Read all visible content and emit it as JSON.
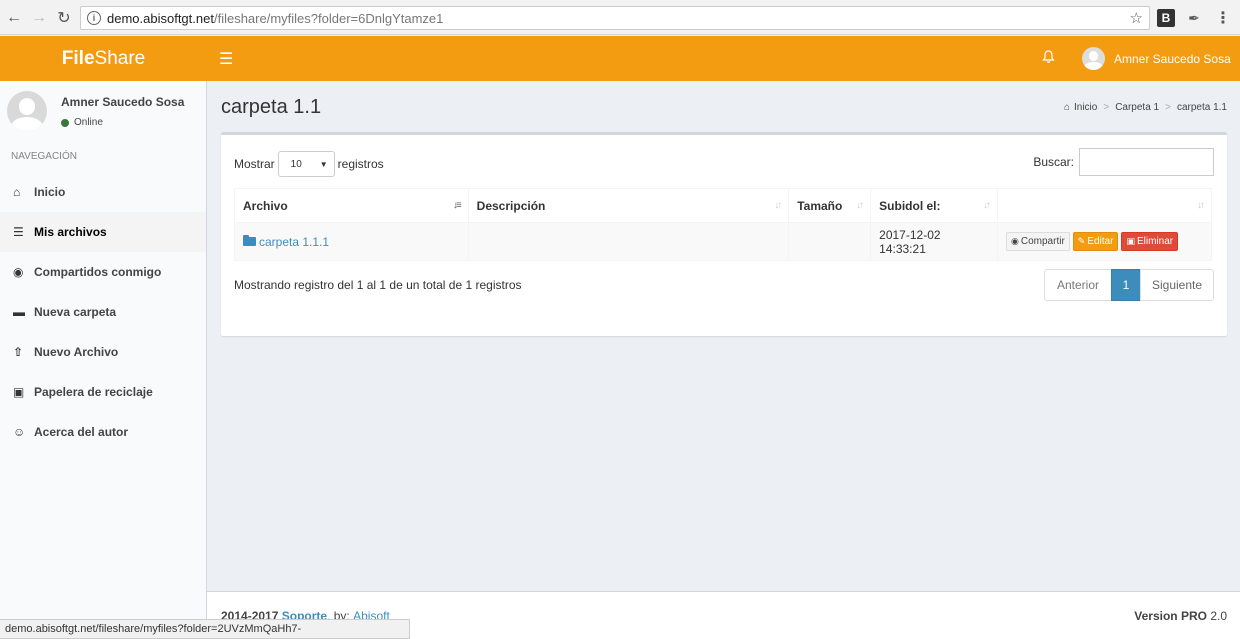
{
  "browser": {
    "url_host": "demo.abisoftgt.net",
    "url_path": "/fileshare/myfiles?folder=6DnlgYtamze1",
    "ext_b_label": "B"
  },
  "header": {
    "logo_bold": "File",
    "logo_rest": "Share",
    "user_name": "Amner Saucedo Sosa"
  },
  "sidebar": {
    "user_name": "Amner Saucedo Sosa",
    "status": "Online",
    "nav_header": "NAVEGACIÓN",
    "items": [
      {
        "label": "Inicio",
        "icon": "home-icon"
      },
      {
        "label": "Mis archivos",
        "icon": "database-icon"
      },
      {
        "label": "Compartidos conmigo",
        "icon": "globe-icon"
      },
      {
        "label": "Nueva carpeta",
        "icon": "folder-icon"
      },
      {
        "label": "Nuevo Archivo",
        "icon": "upload-icon"
      },
      {
        "label": "Papelera de reciclaje",
        "icon": "trash-icon"
      },
      {
        "label": "Acerca del autor",
        "icon": "smile-icon"
      }
    ]
  },
  "content": {
    "title": "carpeta 1.1",
    "breadcrumb": [
      "Inicio",
      "Carpeta 1",
      "carpeta 1.1"
    ]
  },
  "table_controls": {
    "show_label": "Mostrar",
    "page_size": "10",
    "records_label": "registros",
    "search_label": "Buscar:",
    "search_value": ""
  },
  "table": {
    "columns": [
      "Archivo",
      "Descripción",
      "Tamaño",
      "Subidol el:",
      ""
    ],
    "rows": [
      {
        "archivo": "carpeta 1.1.1",
        "descripcion": "",
        "tamano": "",
        "subido": "2017-12-02 14:33:21",
        "actions": [
          "Compartir",
          "Editar",
          "Eliminar"
        ]
      }
    ]
  },
  "pagination": {
    "info": "Mostrando registro del 1 al 1 de un total de 1 registros",
    "prev": "Anterior",
    "current": "1",
    "next": "Siguiente"
  },
  "footer": {
    "copyright": "2014-2017",
    "support_link": "Soporte",
    "by_label": ". by:",
    "author_link": "Abisoft",
    "version_label": "Version PRO",
    "version_number": "2.0"
  },
  "statusbar": {
    "text": "demo.abisoftgt.net/fileshare/myfiles?folder=2UVzMmQaHh7-"
  },
  "colors": {
    "brand": "#f39c12",
    "primary": "#3c8dbc",
    "danger": "#dd4b39",
    "online": "#3c763d"
  }
}
